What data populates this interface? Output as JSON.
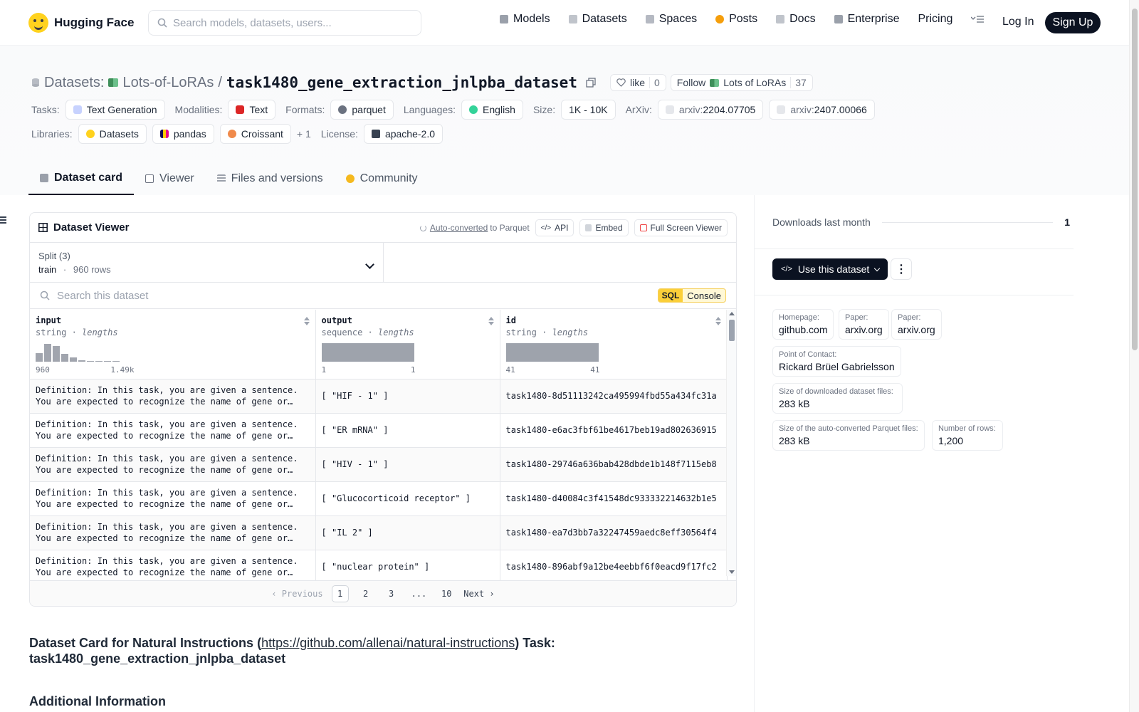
{
  "brand": "Hugging Face",
  "search": {
    "placeholder": "Search models, datasets, users..."
  },
  "nav": [
    {
      "label": "Models",
      "color": "#9aa0aa"
    },
    {
      "label": "Datasets",
      "color": "#c0c4cb"
    },
    {
      "label": "Spaces",
      "color": "#b5b9c2"
    },
    {
      "label": "Posts",
      "color": "#f59e0b"
    },
    {
      "label": "Docs",
      "color": "#c0c4cb"
    },
    {
      "label": "Enterprise",
      "color": "#9aa0aa"
    },
    {
      "label": "Pricing",
      "color": ""
    }
  ],
  "auth": {
    "login": "Log In",
    "signup": "Sign Up"
  },
  "repo": {
    "section": "Datasets:",
    "owner": "Lots-of-LoRAs",
    "separator": "/",
    "name": "task1480_gene_extraction_jnlpba_dataset",
    "like_label": "like",
    "like_count": "0",
    "follow_label": "Follow",
    "follow_org": "Lots of LoRAs",
    "follow_count": "37"
  },
  "tags": {
    "tasks_label": "Tasks:",
    "task": "Text Generation",
    "modalities_label": "Modalities:",
    "modality": "Text",
    "formats_label": "Formats:",
    "format": "parquet",
    "languages_label": "Languages:",
    "language": "English",
    "size_label": "Size:",
    "size": "1K - 10K",
    "arxiv_label": "ArXiv:",
    "arxiv_prefix": "arxiv:",
    "arxiv1": "2204.07705",
    "arxiv2": "2407.00066",
    "libraries_label": "Libraries:",
    "lib1": "Datasets",
    "lib2": "pandas",
    "lib3": "Croissant",
    "lib_more": "+ 1",
    "license_label": "License:",
    "license": "apache-2.0"
  },
  "tabs": [
    "Dataset card",
    "Viewer",
    "Files and versions",
    "Community"
  ],
  "viewer": {
    "title": "Dataset Viewer",
    "auto_converted": "Auto-converted",
    "to_parquet": "to Parquet",
    "api": "API",
    "embed": "Embed",
    "full_screen": "Full Screen Viewer",
    "split_label": "Split (3)",
    "split_value": "train",
    "split_dot": "·",
    "split_rows": "960 rows",
    "search_placeholder": "Search this dataset",
    "sql": "SQL",
    "console": "Console",
    "columns": [
      {
        "name": "input",
        "type": "string",
        "stat": "lengths",
        "min": "960",
        "max": "1.49k",
        "hist": [
          0.45,
          0.95,
          0.85,
          0.42,
          0.22,
          0.08,
          0.04,
          0.04,
          0.04,
          0.04
        ]
      },
      {
        "name": "output",
        "type": "sequence",
        "stat": "lengths",
        "min": "1",
        "max": "1",
        "hist": [
          1.0
        ]
      },
      {
        "name": "id",
        "type": "string",
        "stat": "lengths",
        "min": "41",
        "max": "41",
        "hist": [
          1.0
        ]
      }
    ],
    "rows": [
      {
        "line1": "Definition: In this task, you are given a sentence.",
        "line2": "You are expected to recognize the name of gene or…",
        "output": "[ \"HIF - 1\" ]",
        "id": "task1480-8d51113242ca495994fbd55a434fc31a"
      },
      {
        "line1": "Definition: In this task, you are given a sentence.",
        "line2": "You are expected to recognize the name of gene or…",
        "output": "[ \"ER mRNA\" ]",
        "id": "task1480-e6ac3fbf61be4617beb19ad802636915"
      },
      {
        "line1": "Definition: In this task, you are given a sentence.",
        "line2": "You are expected to recognize the name of gene or…",
        "output": "[ \"HIV - 1\" ]",
        "id": "task1480-29746a636bab428dbde1b148f7115eb8"
      },
      {
        "line1": "Definition: In this task, you are given a sentence.",
        "line2": "You are expected to recognize the name of gene or…",
        "output": "[ \"Glucocorticoid receptor\" ]",
        "id": "task1480-d40084c3f41548dc933332214632b1e5"
      },
      {
        "line1": "Definition: In this task, you are given a sentence.",
        "line2": "You are expected to recognize the name of gene or…",
        "output": "[ \"IL 2\" ]",
        "id": "task1480-ea7d3bb7a32247459aedc8eff30564f4"
      },
      {
        "line1": "Definition: In this task, you are given a sentence.",
        "line2": "You are expected to recognize the name of gene or…",
        "output": "[ \"nuclear protein\" ]",
        "id": "task1480-896abf9a12be4eebbf6f0eacd9f17fc2"
      }
    ],
    "pager": {
      "prev": "Previous",
      "pages": [
        "1",
        "2",
        "3",
        "...",
        "10"
      ],
      "next": "Next"
    }
  },
  "card": {
    "title_prefix": "Dataset Card for Natural Instructions (",
    "title_link": "https://github.com/allenai/natural-instructions",
    "title_suffix": ") Task:",
    "title_line2": "task1480_gene_extraction_jnlpba_dataset",
    "h2": "Additional Information"
  },
  "side": {
    "downloads_label": "Downloads last month",
    "downloads_value": "1",
    "use_dataset": "Use this dataset",
    "more": "⋮",
    "meta": [
      {
        "label": "Homepage:",
        "value": "github.com"
      },
      {
        "label": "Paper:",
        "value": "arxiv.org"
      },
      {
        "label": "Paper:",
        "value": "arxiv.org"
      },
      {
        "label": "Point of Contact:",
        "value": "Rickard Brüel Gabrielsson"
      },
      {
        "label": "Size of downloaded dataset files:",
        "value": "283 kB"
      },
      {
        "label": "Size of the auto-converted Parquet files:",
        "value": "283 kB"
      },
      {
        "label": "Number of rows:",
        "value": "1,200"
      }
    ]
  }
}
